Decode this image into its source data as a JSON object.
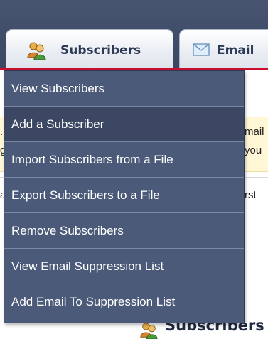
{
  "nav": {
    "tabs": [
      {
        "label": "Subscribers",
        "icon": "subscribers-icon",
        "active": true
      },
      {
        "label": "Email",
        "icon": "envelope-icon",
        "active": false
      }
    ]
  },
  "dropdown_menu": {
    "items": [
      {
        "label": "View Subscribers"
      },
      {
        "label": "Add a Subscriber",
        "hovered": true
      },
      {
        "label": "Import Subscribers from a File"
      },
      {
        "label": "Export Subscribers to a File"
      },
      {
        "label": "Remove Subscribers"
      },
      {
        "label": "View Email Suppression List"
      },
      {
        "label": "Add Email To Suppression List"
      }
    ]
  },
  "background": {
    "yellow_panel": {
      "left_fragments": [
        ".",
        "g"
      ],
      "right_fragments": [
        "mail",
        "you"
      ]
    },
    "row_fragments": {
      "left": "a",
      "right": "rst"
    },
    "section_heading": "Subscribers"
  },
  "colors": {
    "header_bg": "#3f4d69",
    "menu_bg": "#4b5a78",
    "menu_hover_bg": "#3b4763",
    "accent_red": "#c8102e",
    "panel_yellow": "#fff7d6"
  }
}
